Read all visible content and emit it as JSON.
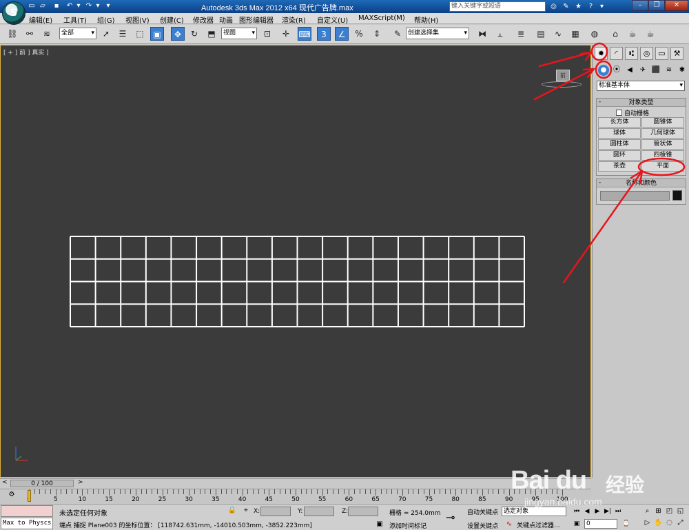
{
  "titlebar": {
    "title": "Autodesk 3ds Max  2012 x64      现代广告牌.max",
    "search_placeholder": "键入关键字或短语"
  },
  "menu": [
    "编辑(E)",
    "工具(T)",
    "组(G)",
    "视图(V)",
    "创建(C)",
    "修改器",
    "动画",
    "图形编辑器",
    "渲染(R)",
    "自定义(U)",
    "MAXScript(M)",
    "帮助(H)"
  ],
  "toolbar": {
    "selection_filter": "全部",
    "ref_coord": "视图",
    "named_selection": "创建选择集"
  },
  "viewport": {
    "label": "[ + ] 前 ] 真实 ]",
    "viewcube_label": "前",
    "grid_rows": 4,
    "grid_cols": 18
  },
  "command_panel": {
    "category": "标准基本体",
    "object_type_title": "对象类型",
    "autogrid_label": "自动栅格",
    "object_buttons": [
      [
        "长方体",
        "圆锥体"
      ],
      [
        "球体",
        "几何球体"
      ],
      [
        "圆柱体",
        "管状体"
      ],
      [
        "圆环",
        "四棱锥"
      ],
      [
        "茶壶",
        "平面"
      ]
    ],
    "name_color_title": "名称和颜色"
  },
  "timeline": {
    "slider_label": "0 / 100",
    "ticks": [
      "0",
      "5",
      "10",
      "15",
      "20",
      "25",
      "30",
      "35",
      "40",
      "45",
      "50",
      "55",
      "60",
      "65",
      "70",
      "75",
      "80",
      "85",
      "90",
      "95",
      "100"
    ]
  },
  "status": {
    "listener_text": "Max to Physcs (",
    "selection": "未选定任何对象",
    "x_label": "X:",
    "y_label": "Y:",
    "z_label": "Z:",
    "grid": "栅格 = 254.0mm",
    "prompt": "端点 捕捉 Plane003 的坐标位置： [118742.631mm, -14010.503mm, -3852.223mm]",
    "add_time_tag": "添加时间标记",
    "auto_key": "自动关键点",
    "auto_key_value": "选定对象",
    "set_key": "设置关键点",
    "key_filters": "关键点过滤器...",
    "frame": "0"
  },
  "watermark": {
    "logo": "Bai du",
    "cn": "经验",
    "url": "jingyan.baidu.com"
  },
  "colors": {
    "annotation": "#e8141c",
    "viewport_bg": "#3b3b3b",
    "active_border": "#e2b33a"
  }
}
